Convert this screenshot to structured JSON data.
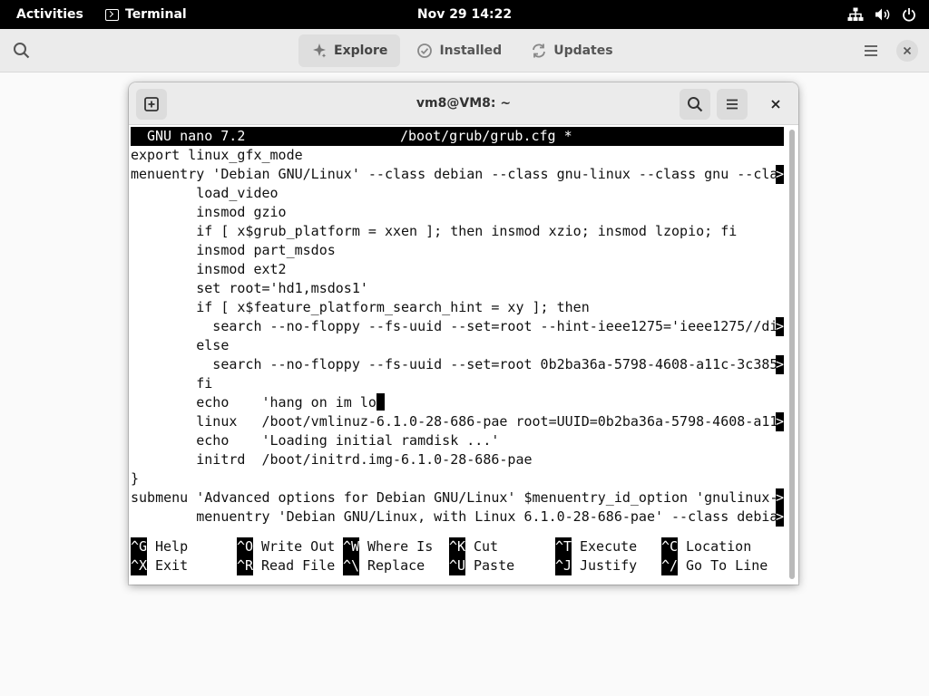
{
  "topbar": {
    "activities": "Activities",
    "app_name": "Terminal",
    "clock": "Nov 29  14:22",
    "tray_icons": [
      "network-icon",
      "volume-icon",
      "power-icon"
    ]
  },
  "software": {
    "tabs": [
      {
        "label": "Explore",
        "icon": "explore-icon",
        "active": true
      },
      {
        "label": "Installed",
        "icon": "installed-icon",
        "active": false
      },
      {
        "label": "Updates",
        "icon": "updates-icon",
        "active": false
      }
    ]
  },
  "terminal": {
    "title": "vm8@VM8: ~"
  },
  "nano": {
    "version": "GNU nano 7.2",
    "filename": "/boot/grub/grub.cfg *",
    "lines": [
      {
        "text": "export linux_gfx_mode",
        "truncated": false
      },
      {
        "text": "menuentry 'Debian GNU/Linux' --class debian --class gnu-linux --class gnu --cla",
        "truncated": true
      },
      {
        "text": "        load_video",
        "truncated": false
      },
      {
        "text": "        insmod gzio",
        "truncated": false
      },
      {
        "text": "        if [ x$grub_platform = xxen ]; then insmod xzio; insmod lzopio; fi",
        "truncated": false
      },
      {
        "text": "        insmod part_msdos",
        "truncated": false
      },
      {
        "text": "        insmod ext2",
        "truncated": false
      },
      {
        "text": "        set root='hd1,msdos1'",
        "truncated": false
      },
      {
        "text": "        if [ x$feature_platform_search_hint = xy ]; then",
        "truncated": false
      },
      {
        "text": "          search --no-floppy --fs-uuid --set=root --hint-ieee1275='ieee1275//di",
        "truncated": true
      },
      {
        "text": "        else",
        "truncated": false
      },
      {
        "text": "          search --no-floppy --fs-uuid --set=root 0b2ba36a-5798-4608-a11c-3c385",
        "truncated": true
      },
      {
        "text": "        fi",
        "truncated": false
      },
      {
        "text": "        echo    'hang on im lo",
        "truncated": false,
        "cursor": true
      },
      {
        "text": "        linux   /boot/vmlinuz-6.1.0-28-686-pae root=UUID=0b2ba36a-5798-4608-a11",
        "truncated": true
      },
      {
        "text": "        echo    'Loading initial ramdisk ...'",
        "truncated": false
      },
      {
        "text": "        initrd  /boot/initrd.img-6.1.0-28-686-pae",
        "truncated": false
      },
      {
        "text": "}",
        "truncated": false
      },
      {
        "text": "submenu 'Advanced options for Debian GNU/Linux' $menuentry_id_option 'gnulinux-",
        "truncated": true
      },
      {
        "text": "        menuentry 'Debian GNU/Linux, with Linux 6.1.0-28-686-pae' --class debia",
        "truncated": true
      }
    ],
    "truncation_marker": ">",
    "shortcuts_row1": [
      {
        "key": "^G",
        "label": "Help"
      },
      {
        "key": "^O",
        "label": "Write Out"
      },
      {
        "key": "^W",
        "label": "Where Is"
      },
      {
        "key": "^K",
        "label": "Cut"
      },
      {
        "key": "^T",
        "label": "Execute"
      },
      {
        "key": "^C",
        "label": "Location"
      }
    ],
    "shortcuts_row2": [
      {
        "key": "^X",
        "label": "Exit"
      },
      {
        "key": "^R",
        "label": "Read File"
      },
      {
        "key": "^\\",
        "label": "Replace"
      },
      {
        "key": "^U",
        "label": "Paste"
      },
      {
        "key": "^J",
        "label": "Justify"
      },
      {
        "key": "^/",
        "label": "Go To Line"
      }
    ]
  }
}
